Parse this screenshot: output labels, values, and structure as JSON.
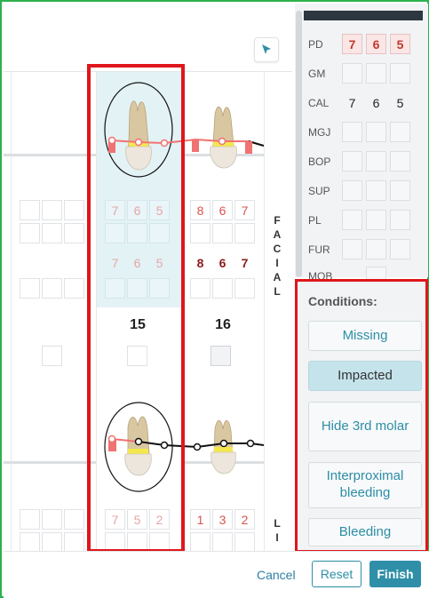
{
  "toolbar": {
    "cursor_icon": "cursor-arrow-icon"
  },
  "teeth": [
    {
      "number": "15",
      "facial_top": [
        "7",
        "6",
        "5"
      ],
      "facial_mid": [
        "7",
        "6",
        "5"
      ],
      "lingual": [
        "7",
        "5",
        "2"
      ]
    },
    {
      "number": "16",
      "facial_top": [
        "8",
        "6",
        "7"
      ],
      "facial_mid": [
        "8",
        "6",
        "7"
      ],
      "lingual": [
        "1",
        "3",
        "2"
      ]
    }
  ],
  "side_labels": {
    "facial": [
      "F",
      "A",
      "C",
      "I",
      "A",
      "L"
    ],
    "lingual": [
      "L",
      "I"
    ]
  },
  "measures": [
    {
      "label": "PD",
      "values": [
        "7",
        "6",
        "5"
      ],
      "style": "pd"
    },
    {
      "label": "GM",
      "values": [
        "",
        "",
        ""
      ],
      "style": "box"
    },
    {
      "label": "CAL",
      "values": [
        "7",
        "6",
        "5"
      ],
      "style": "plain"
    },
    {
      "label": "MGJ",
      "values": [
        "",
        "",
        ""
      ],
      "style": "box"
    },
    {
      "label": "BOP",
      "values": [
        "",
        "",
        ""
      ],
      "style": "box"
    },
    {
      "label": "SUP",
      "values": [
        "",
        "",
        ""
      ],
      "style": "box"
    },
    {
      "label": "PL",
      "values": [
        "",
        "",
        ""
      ],
      "style": "box"
    },
    {
      "label": "FUR",
      "values": [
        "",
        "",
        ""
      ],
      "style": "box"
    },
    {
      "label": "MOB",
      "values": [
        ""
      ],
      "style": "box"
    }
  ],
  "conditions": {
    "title": "Conditions:",
    "buttons": [
      {
        "label": "Missing",
        "active": false
      },
      {
        "label": "Impacted",
        "active": true
      },
      {
        "label": "Hide 3rd molar",
        "active": false
      },
      {
        "label": "Interproximal bleeding",
        "active": false
      },
      {
        "label": "Bleeding",
        "active": false
      }
    ]
  },
  "footer": {
    "cancel": "Cancel",
    "reset": "Reset",
    "finish": "Finish"
  },
  "colors": {
    "accent": "#2f8fa8",
    "highlight": "#e0161b",
    "pd_red": "#d9534f"
  }
}
